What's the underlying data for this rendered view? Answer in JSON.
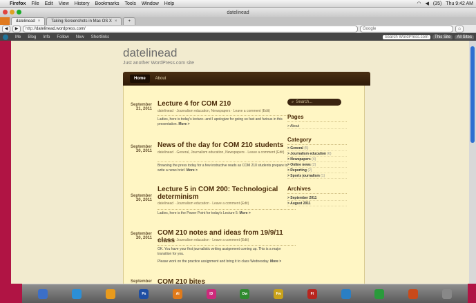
{
  "menubar": {
    "items": [
      "Firefox",
      "File",
      "Edit",
      "View",
      "History",
      "Bookmarks",
      "Tools",
      "Window",
      "Help"
    ],
    "battery": "(35)",
    "clock": "Thu 9:42 AM"
  },
  "window": {
    "title": "datelinead"
  },
  "tabs": [
    {
      "label": "datelinead"
    },
    {
      "label": "Taking Screenshots in Mac OS X"
    }
  ],
  "navbar": {
    "url_prefix": "http://",
    "url": "datelinead.wordpress.com/",
    "search_placeholder": "Google"
  },
  "wpbar": {
    "items": [
      "Me",
      "Blog",
      "Info",
      "Follow",
      "New",
      "Shortlinks"
    ],
    "search": "Search WordPress.com",
    "this_site": "This Site",
    "all_sites": "All Sites"
  },
  "blog": {
    "title": "datelinead",
    "tagline": "Just another WordPress.com site",
    "nav": [
      "Home",
      "About"
    ]
  },
  "posts": [
    {
      "date_md": "September",
      "date_y": "21, 2011",
      "title": "Lecture 4 for COM 210",
      "meta": "datelinead  ·  Journalism education, Newspapers  ·  Leave a comment  (Edit)",
      "body": "Ladies, here is today's lecture--and I apologize for going so fast and furious in this presentation.",
      "more": "More >"
    },
    {
      "date_md": "September",
      "date_y": "20, 2011",
      "title": "News of the day for COM 210 students",
      "meta": "datelinead  ·  General, Journalism education, Newspapers  ·  Leave a comment  (Edit)",
      "body": "Browsing the press today for a few instructive reads as COM 210 students prepare to write a news brief.",
      "more": "More >"
    },
    {
      "date_md": "September",
      "date_y": "20, 2011",
      "title": "Lecture 5 in COM 200: Technological determinism",
      "meta": "datelinead  ·  Journalism education  ·  Leave a comment  (Edit)",
      "body": "Ladies, here is the Power Point for today's Lecture 5:",
      "more": "More >"
    },
    {
      "date_md": "September",
      "date_y": "20, 2011",
      "title": "COM 210 notes and ideas from 19/9/11 class",
      "meta": "datelinead  ·  Journalism education  ·  Leave a comment  (Edit)",
      "body": "OK. You have your first journalistic writing assignment coming up. This is a major transition for you.",
      "body2": "Please work on the practice assignment and bring it to class Wednesday.",
      "more": "More >"
    },
    {
      "date_md": "September",
      "date_y": "",
      "title": "COM 210 bites",
      "meta": "",
      "body": "",
      "more": ""
    }
  ],
  "sidebar": {
    "search_placeholder": "Search...",
    "pages_heading": "Pages",
    "pages": [
      "> About"
    ],
    "category_heading": "Category",
    "categories": [
      {
        "name": "> General",
        "count": "(5)"
      },
      {
        "name": "> Journalism education",
        "count": "(6)"
      },
      {
        "name": "> Newspapers",
        "count": "(4)"
      },
      {
        "name": "> Online news",
        "count": "(2)"
      },
      {
        "name": "> Reporting",
        "count": "(2)"
      },
      {
        "name": "> Sports journalism",
        "count": "(1)"
      }
    ],
    "archives_heading": "Archives",
    "archives": [
      "> September 2011",
      "> August 2011"
    ]
  },
  "dock": [
    "Ps",
    "Ai",
    "ID",
    "Dw",
    "Fw",
    "Fl"
  ]
}
